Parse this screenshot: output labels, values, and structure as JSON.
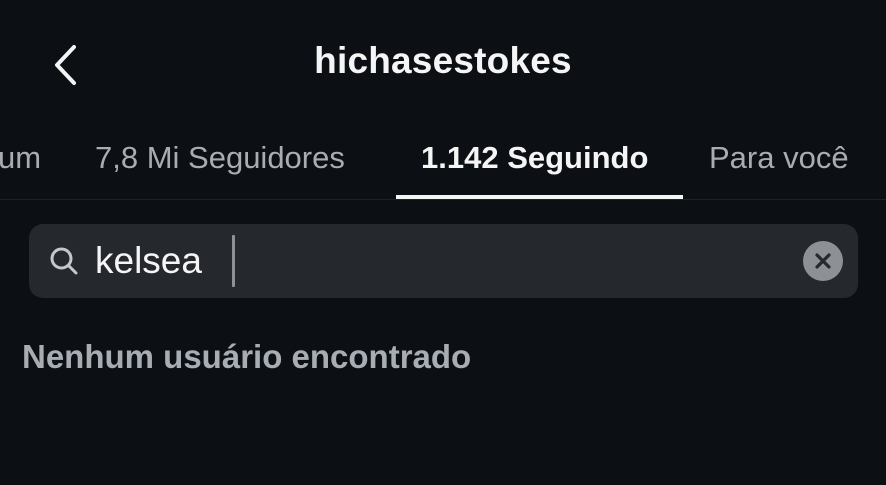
{
  "header": {
    "title": "hichasestokes",
    "back_icon": "chevron-left-icon"
  },
  "tabs": [
    {
      "label": "um",
      "active": false
    },
    {
      "label": "7,8 Mi Seguidores",
      "active": false
    },
    {
      "label": "1.142 Seguindo",
      "active": true
    },
    {
      "label": "Para você",
      "active": false
    }
  ],
  "search": {
    "icon": "search-icon",
    "value": "kelsea",
    "clear_icon": "close-icon"
  },
  "results": {
    "empty_message": "Nenhum usuário encontrado"
  },
  "colors": {
    "background": "#0c1014",
    "search_field": "#25292e",
    "text_primary": "#f5f5f5",
    "text_secondary": "#a8adb3",
    "clear_button": "#8d9196"
  }
}
